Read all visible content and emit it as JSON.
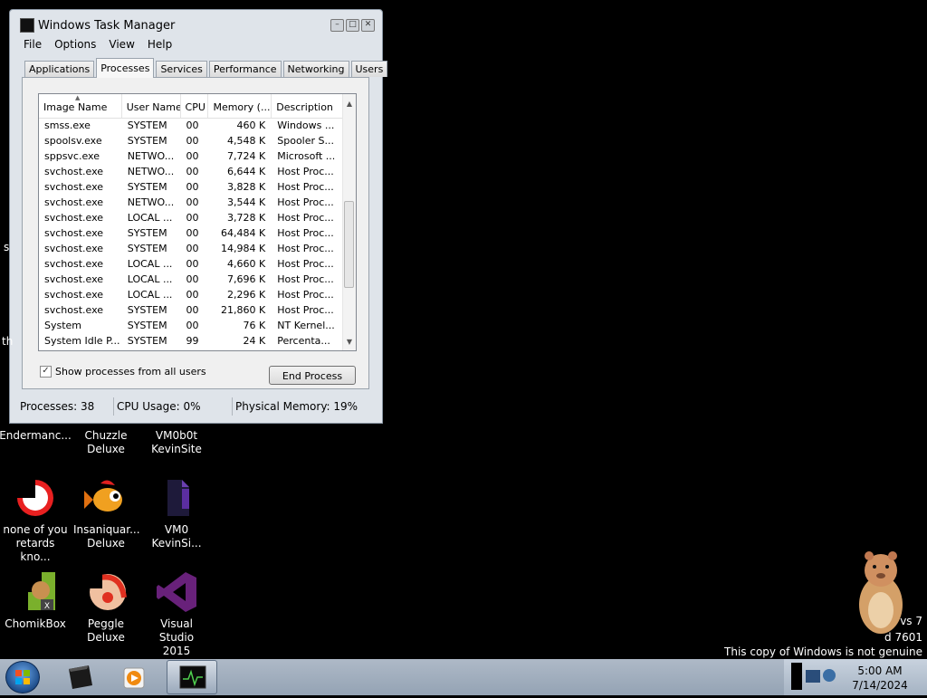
{
  "window": {
    "title": "Windows Task Manager",
    "controls": {
      "minimize": "–",
      "maximize": "□",
      "close": "✕"
    }
  },
  "menu": [
    "File",
    "Options",
    "View",
    "Help"
  ],
  "tabs": [
    "Applications",
    "Processes",
    "Services",
    "Performance",
    "Networking",
    "Users"
  ],
  "active_tab": "Processes",
  "processes": {
    "columns": [
      "Image Name",
      "User Name",
      "CPU",
      "Memory (...",
      "Description"
    ],
    "rows": [
      [
        "smss.exe",
        "SYSTEM",
        "00",
        "460 K",
        "Windows ..."
      ],
      [
        "spoolsv.exe",
        "SYSTEM",
        "00",
        "4,548 K",
        "Spooler S..."
      ],
      [
        "sppsvc.exe",
        "NETWO...",
        "00",
        "7,724 K",
        "Microsoft ..."
      ],
      [
        "svchost.exe",
        "NETWO...",
        "00",
        "6,644 K",
        "Host Proc..."
      ],
      [
        "svchost.exe",
        "SYSTEM",
        "00",
        "3,828 K",
        "Host Proc..."
      ],
      [
        "svchost.exe",
        "NETWO...",
        "00",
        "3,544 K",
        "Host Proc..."
      ],
      [
        "svchost.exe",
        "LOCAL ...",
        "00",
        "3,728 K",
        "Host Proc..."
      ],
      [
        "svchost.exe",
        "SYSTEM",
        "00",
        "64,484 K",
        "Host Proc..."
      ],
      [
        "svchost.exe",
        "SYSTEM",
        "00",
        "14,984 K",
        "Host Proc..."
      ],
      [
        "svchost.exe",
        "LOCAL ...",
        "00",
        "4,660 K",
        "Host Proc..."
      ],
      [
        "svchost.exe",
        "LOCAL ...",
        "00",
        "7,696 K",
        "Host Proc..."
      ],
      [
        "svchost.exe",
        "LOCAL ...",
        "00",
        "2,296 K",
        "Host Proc..."
      ],
      [
        "svchost.exe",
        "SYSTEM",
        "00",
        "21,860 K",
        "Host Proc..."
      ],
      [
        "System",
        "SYSTEM",
        "00",
        "76 K",
        "NT Kernel..."
      ],
      [
        "System Idle P...",
        "SYSTEM",
        "99",
        "24 K",
        "Percenta..."
      ]
    ],
    "show_all_users_label": "Show processes from all users",
    "show_all_users_checked": true,
    "end_process_label": "End Process"
  },
  "status": {
    "processes": "Processes: 38",
    "cpu": "CPU Usage: 0%",
    "memory": "Physical Memory: 19%"
  },
  "desktop_icons": {
    "endermance": "Endermanc...",
    "chuzzle": "Chuzzle Deluxe",
    "vm0b0t": "VM0b0t KevinSite",
    "none_of_you": "none of you retards kno...",
    "insaniquarium": "Insaniquar... Deluxe",
    "vm0_kevinsite": "VM0 KevinSi...",
    "chomikbox": "ChomikBox",
    "peggle": "Peggle Deluxe",
    "visual_studio": "Visual Studio 2015"
  },
  "desktop_edge": {
    "s": "s",
    "th": "th"
  },
  "watermark": {
    "line1": "vs 7",
    "line2": "d 7601",
    "line3": "This copy of Windows is not genuine"
  },
  "taskbar": {
    "time": "5:00 AM",
    "date": "7/14/2024"
  }
}
